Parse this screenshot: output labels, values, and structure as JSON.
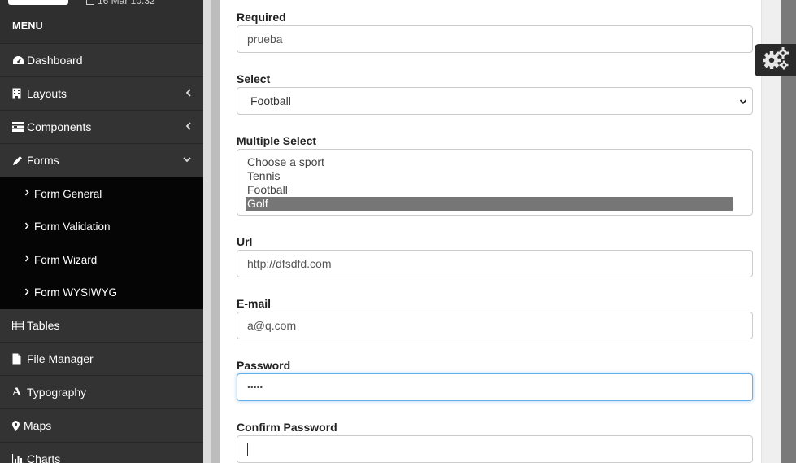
{
  "header": {
    "date": "16 Mar 10:32"
  },
  "sidebar": {
    "menu_title": "MENU",
    "items": [
      {
        "label": "Dashboard",
        "icon": "dashboard-icon"
      },
      {
        "label": "Layouts",
        "icon": "building-icon"
      },
      {
        "label": "Components",
        "icon": "components-icon"
      },
      {
        "label": "Forms",
        "icon": "pencil-icon"
      },
      {
        "label": "Tables",
        "icon": "table-icon"
      },
      {
        "label": "File Manager",
        "icon": "file-icon"
      },
      {
        "label": "Typography",
        "icon": "font-icon"
      },
      {
        "label": "Maps",
        "icon": "map-marker-icon"
      },
      {
        "label": "Charts",
        "icon": "bar-chart-icon"
      }
    ],
    "forms_sub": [
      {
        "label": "Form General"
      },
      {
        "label": "Form Validation"
      },
      {
        "label": "Form Wizard"
      },
      {
        "label": "Form WYSIWYG"
      }
    ]
  },
  "form": {
    "required": {
      "label": "Required",
      "value": "prueba"
    },
    "select": {
      "label": "Select",
      "value": "Football"
    },
    "multiple_select": {
      "label": "Multiple Select",
      "options": [
        "Choose a sport",
        "Tennis",
        "Football",
        "Golf"
      ],
      "selected": "Golf"
    },
    "url": {
      "label": "Url",
      "value": "http://dfsdfd.com"
    },
    "email": {
      "label": "E-mail",
      "value": "a@q.com"
    },
    "password": {
      "label": "Password",
      "value": "•••••"
    },
    "confirm_password": {
      "label": "Confirm Password",
      "value": ""
    }
  },
  "colors": {
    "sidebar_bg": "#2f2f2f",
    "submenu_bg": "#050505",
    "focus": "#66afe9",
    "selected_option": "#767676"
  }
}
